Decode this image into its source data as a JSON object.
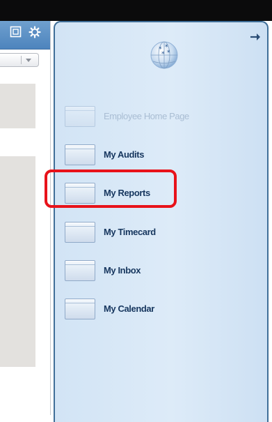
{
  "panel": {
    "items": [
      {
        "label": "Employee Home Page",
        "enabled": false
      },
      {
        "label": "My Audits",
        "enabled": true
      },
      {
        "label": "My Reports",
        "enabled": true
      },
      {
        "label": "My Timecard",
        "enabled": true
      },
      {
        "label": "My Inbox",
        "enabled": true
      },
      {
        "label": "My Calendar",
        "enabled": true
      }
    ],
    "highlighted_item": "My Reports"
  },
  "icons": {
    "expand": "arrow-right-icon",
    "header": "globe-stars-icon",
    "toolbar": [
      "window-icon",
      "gear-icon"
    ],
    "dropdown": "chevron-down-icon"
  },
  "colors": {
    "highlight": "#e8121a",
    "panel_border": "#3f6e98",
    "label": "#16365e",
    "disabled_label": "#a9bdd3"
  }
}
